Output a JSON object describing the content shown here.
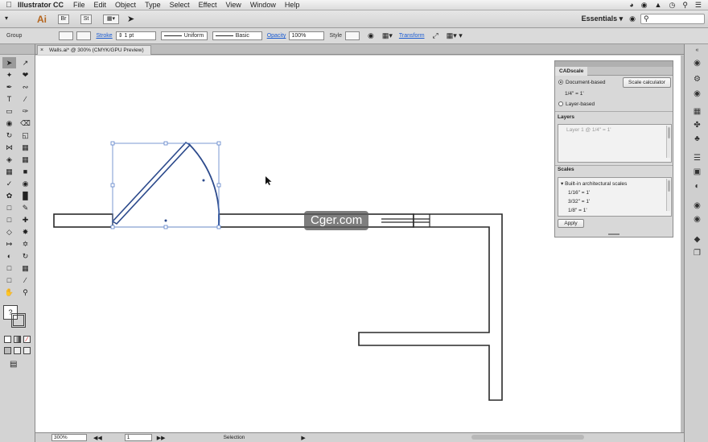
{
  "menubar": {
    "app": "Illustrator CC",
    "items": [
      "File",
      "Edit",
      "Object",
      "Type",
      "Select",
      "Effect",
      "View",
      "Window",
      "Help"
    ]
  },
  "appbar": {
    "logo": "Ai",
    "workspace": "Essentials"
  },
  "control": {
    "selection_type": "Group",
    "stroke_label": "Stroke",
    "stroke_weight": "1 pt",
    "profile": "Uniform",
    "brush": "Basic",
    "opacity_label": "Opacity",
    "opacity": "100%",
    "style_label": "Style",
    "transform_label": "Transform"
  },
  "document": {
    "tab_title": "Walls.ai* @ 300% (CMYK/GPU Preview)"
  },
  "cadscale": {
    "title": "CADscale",
    "document_based": "Document-based",
    "scale_calculator": "Scale calculator",
    "doc_scale": "1/4\" = 1'",
    "layer_based": "Layer-based",
    "layers_label": "Layers",
    "layer_item": "Layer 1 @ 1/4\" = 1'",
    "scales_label": "Scales",
    "scales_group": "Built-in architectural scales",
    "scales": [
      "1/16\" = 1'",
      "3/32\" = 1'",
      "1/8\" = 1'"
    ],
    "apply": "Apply"
  },
  "watermark": "Cger.com",
  "status": {
    "zoom": "300%",
    "page": "1",
    "mode": "Selection"
  }
}
